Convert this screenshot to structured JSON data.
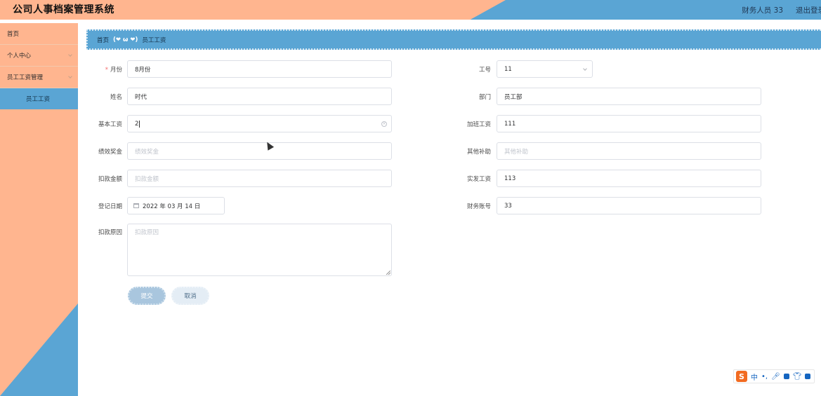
{
  "header": {
    "title": "公司人事档案管理系统",
    "user": "财务人员 33",
    "logout": "退出登录"
  },
  "sidebar": {
    "items": [
      {
        "label": "首页"
      },
      {
        "label": "个人中心"
      },
      {
        "label": "员工工资管理"
      }
    ],
    "sub_item": "员工工资"
  },
  "breadcrumb": {
    "home": "首页",
    "separator": "(❤ ω ❤)",
    "current": "员工工资"
  },
  "form": {
    "month": {
      "label": "月份",
      "value": "8月份"
    },
    "emp_no": {
      "label": "工号",
      "value": "11"
    },
    "name": {
      "label": "姓名",
      "value": "时代"
    },
    "dept": {
      "label": "部门",
      "value": "员工部"
    },
    "base_salary": {
      "label": "基本工资",
      "value": "2"
    },
    "overtime": {
      "label": "加班工资",
      "value": "111"
    },
    "bonus": {
      "label": "绩效奖金",
      "placeholder": "绩效奖金"
    },
    "allowance": {
      "label": "其他补助",
      "placeholder": "其他补助"
    },
    "deduction": {
      "label": "扣款金额",
      "placeholder": "扣款金额"
    },
    "net_pay": {
      "label": "实发工资",
      "value": "113"
    },
    "reg_date": {
      "label": "登记日期",
      "value": "2022 年 03 月 14 日"
    },
    "account": {
      "label": "财务账号",
      "value": "33"
    },
    "deduct_reason": {
      "label": "扣款原因",
      "placeholder": "扣款原因"
    }
  },
  "buttons": {
    "submit": "提交",
    "cancel": "取消"
  },
  "ime": {
    "logo": "S",
    "mode": "中"
  },
  "colors": {
    "peach": "#ffb58f",
    "blue": "#5aa5d4"
  }
}
